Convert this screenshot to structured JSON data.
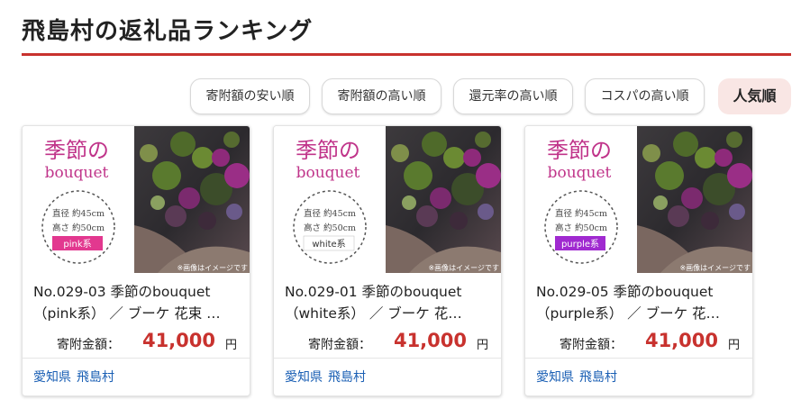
{
  "page": {
    "title": "飛島村の返礼品ランキング",
    "accent_color": "#c8322e"
  },
  "sort": {
    "options": [
      {
        "label": "寄附額の安い順",
        "active": false
      },
      {
        "label": "寄附額の高い順",
        "active": false
      },
      {
        "label": "還元率の高い順",
        "active": false
      },
      {
        "label": "コスパの高い順",
        "active": false
      },
      {
        "label": "人気順",
        "active": true
      }
    ]
  },
  "products": [
    {
      "title_line1": "No.029-03 季節のbouquet",
      "title_line2": "（pink系） ／ ブーケ 花束 …",
      "price_label": "寄附金額：",
      "price": "41,000",
      "unit": "円",
      "prefecture": "愛知県",
      "city": "飛島村",
      "image": {
        "heading_line1": "季節の",
        "heading_line2": "bouquet",
        "diameter": "直径 約45cm",
        "height": "高さ 約50cm",
        "variant": "pink系",
        "variant_color": "#e2388f",
        "note": "※画像はイメージです"
      }
    },
    {
      "title_line1": "No.029-01 季節のbouquet",
      "title_line2": "（white系） ／ ブーケ 花…",
      "price_label": "寄附金額：",
      "price": "41,000",
      "unit": "円",
      "prefecture": "愛知県",
      "city": "飛島村",
      "image": {
        "heading_line1": "季節の",
        "heading_line2": "bouquet",
        "diameter": "直径 約45cm",
        "height": "高さ 約50cm",
        "variant": "white系",
        "variant_color": "#ffffff",
        "note": "※画像はイメージです"
      }
    },
    {
      "title_line1": "No.029-05 季節のbouquet",
      "title_line2": "（purple系） ／ ブーケ 花…",
      "price_label": "寄附金額：",
      "price": "41,000",
      "unit": "円",
      "prefecture": "愛知県",
      "city": "飛島村",
      "image": {
        "heading_line1": "季節の",
        "heading_line2": "bouquet",
        "diameter": "直径 約45cm",
        "height": "高さ 約50cm",
        "variant": "purple系",
        "variant_color": "#a02ad0",
        "note": "※画像はイメージです"
      }
    }
  ]
}
